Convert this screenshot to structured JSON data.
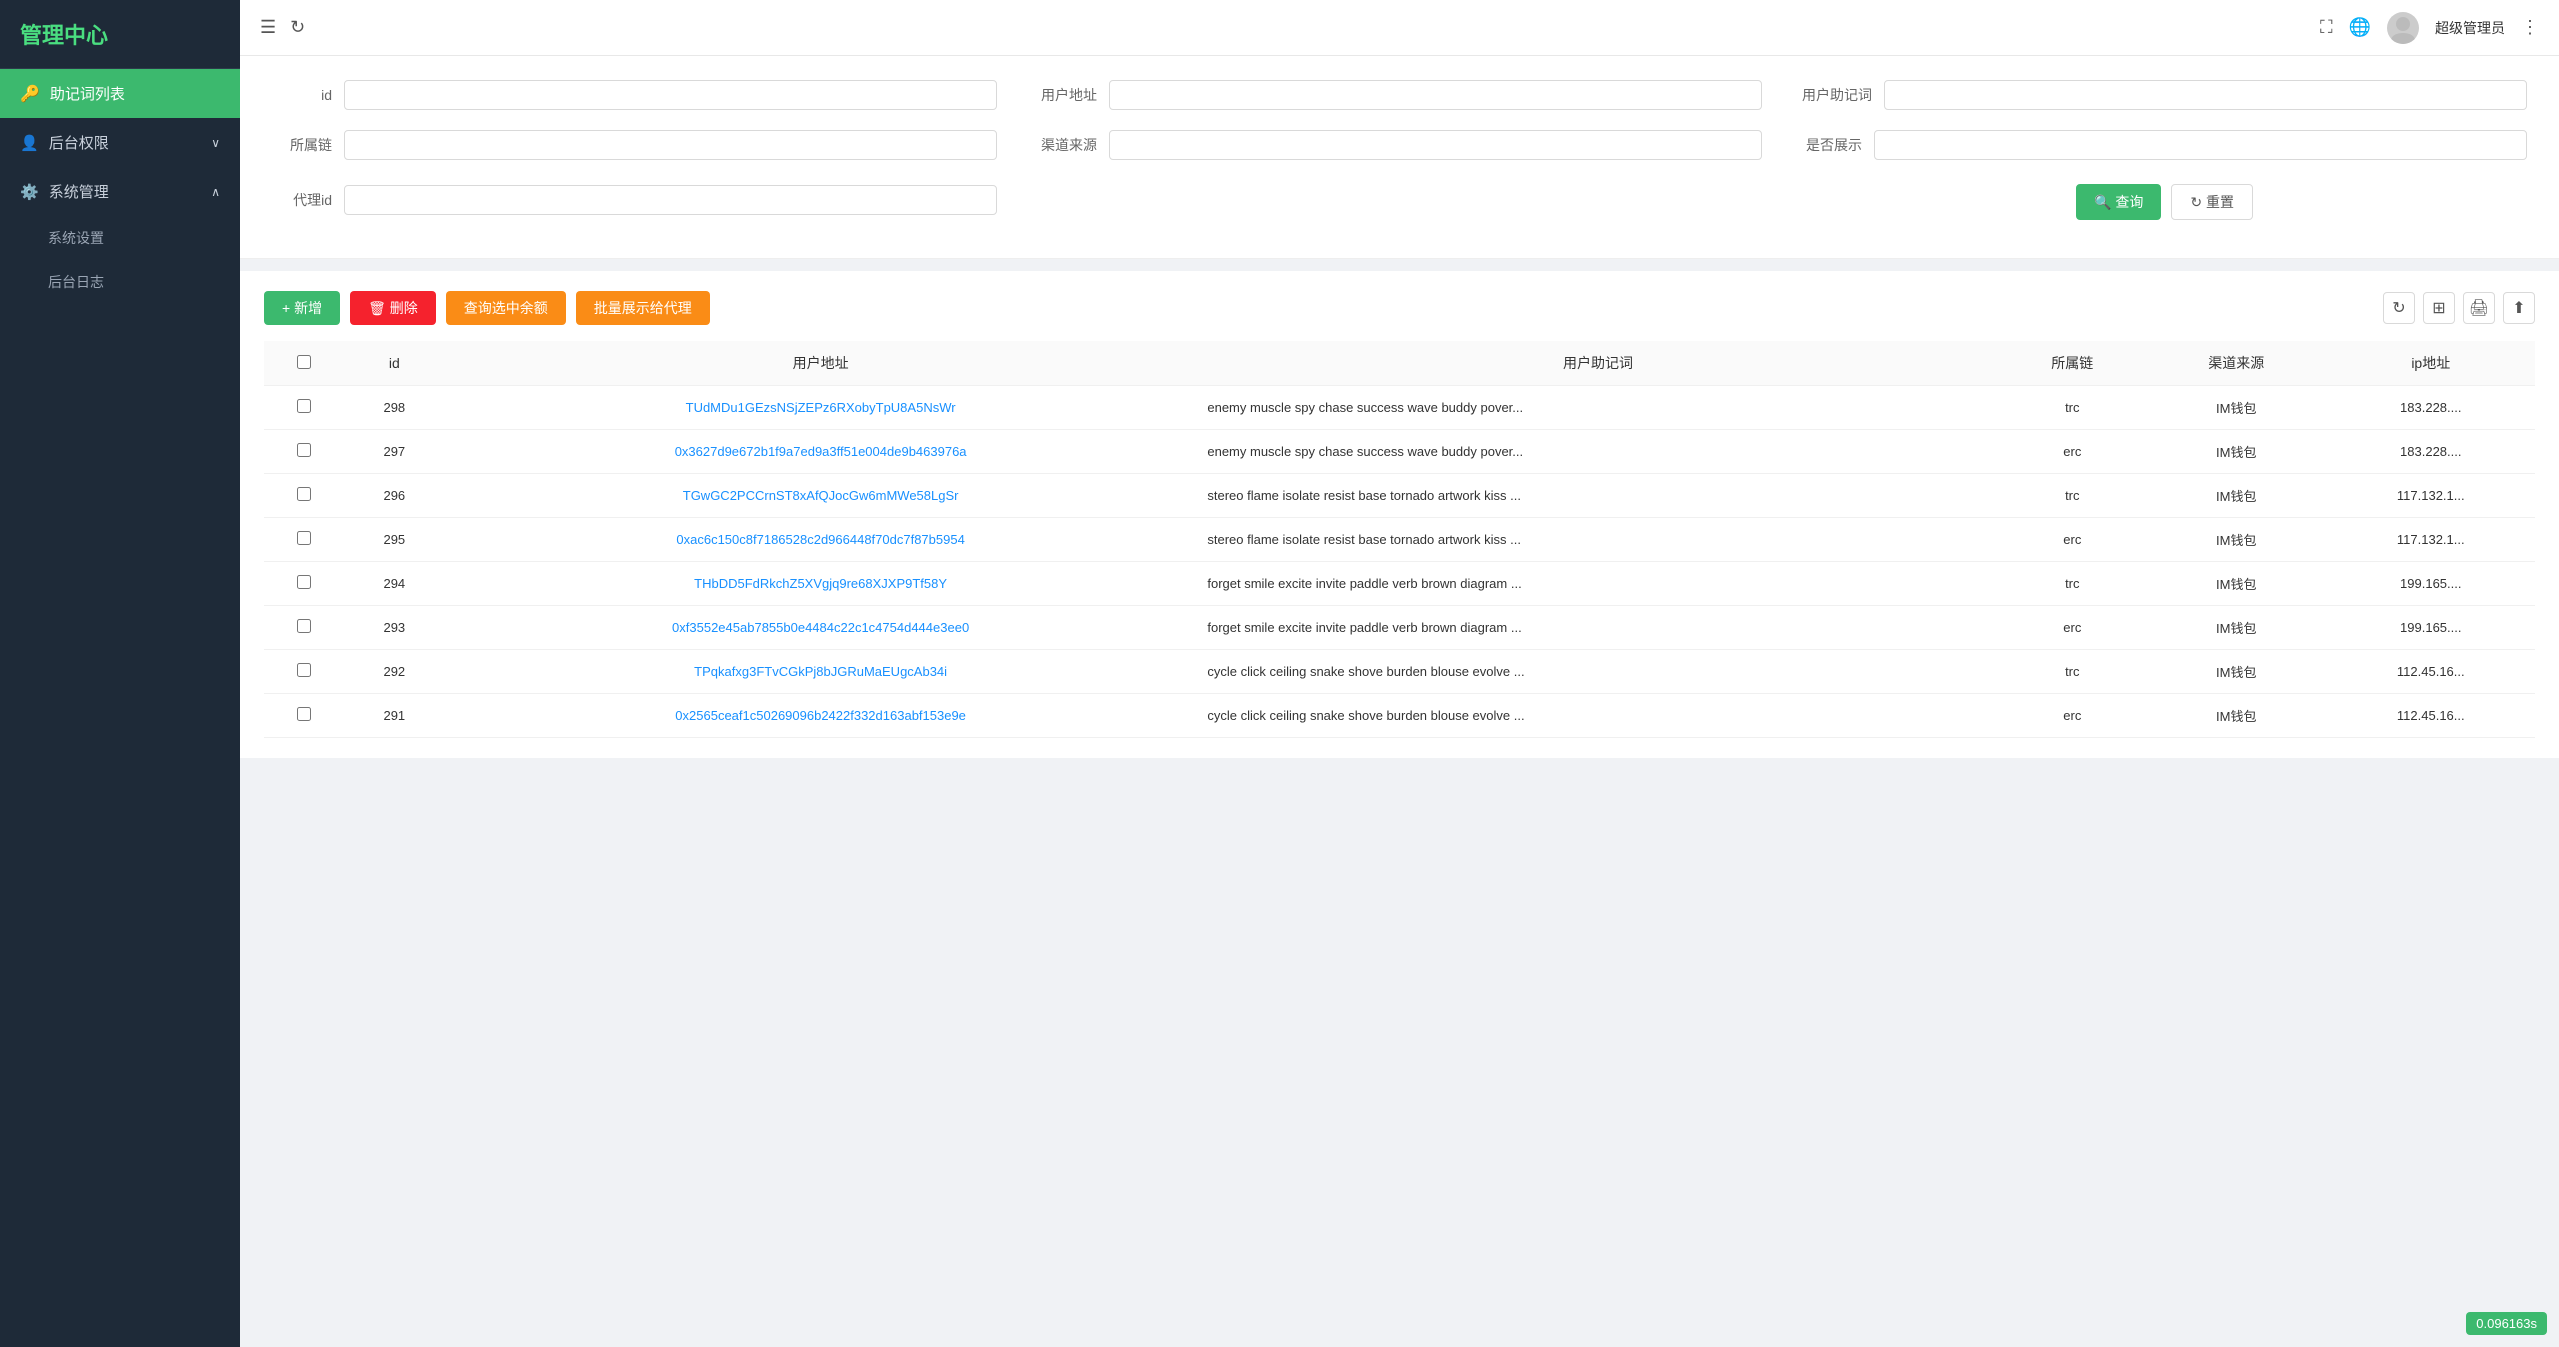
{
  "sidebar": {
    "logo": "管理中心",
    "items": [
      {
        "id": "mnemonic-list",
        "label": "助记词列表",
        "icon": "🔑",
        "active": true
      },
      {
        "id": "backend-permissions",
        "label": "后台权限",
        "icon": "👤",
        "expandable": true,
        "expanded": false
      },
      {
        "id": "system-management",
        "label": "系统管理",
        "icon": "⚙️",
        "expandable": true,
        "expanded": true
      }
    ],
    "sub_items": [
      {
        "id": "system-settings",
        "label": "系统设置"
      },
      {
        "id": "backend-log",
        "label": "后台日志"
      }
    ]
  },
  "topbar": {
    "menu_icon": "☰",
    "refresh_icon": "↻",
    "fullscreen_icon": "⛶",
    "globe_icon": "🌐",
    "username": "超级管理员",
    "more_icon": "⋮"
  },
  "filter": {
    "fields": [
      {
        "id": "id",
        "label": "id",
        "placeholder": ""
      },
      {
        "id": "user-address",
        "label": "用户地址",
        "placeholder": ""
      },
      {
        "id": "user-mnemonic",
        "label": "用户助记词",
        "placeholder": ""
      },
      {
        "id": "chain",
        "label": "所属链",
        "placeholder": ""
      },
      {
        "id": "channel-source",
        "label": "渠道来源",
        "placeholder": ""
      },
      {
        "id": "show-status",
        "label": "是否展示",
        "placeholder": ""
      },
      {
        "id": "agent-id",
        "label": "代理id",
        "placeholder": ""
      }
    ],
    "search_label": "🔍 查询",
    "reset_label": "↻ 重置"
  },
  "toolbar": {
    "add_label": "+ 新增",
    "delete_label": "🗑 删除",
    "query_balance_label": "查询选中余额",
    "batch_show_label": "批量展示给代理"
  },
  "table": {
    "columns": [
      "id",
      "用户地址",
      "用户助记词",
      "所属链",
      "渠道来源",
      "ip地址"
    ],
    "rows": [
      {
        "id": "298",
        "address": "TUdMDu1GEzsNSjZEPz6RXobyTpU8A5NsWr",
        "address_type": "trc",
        "mnemonic": "enemy muscle spy chase success wave buddy pover...",
        "chain": "trc",
        "source": "IM钱包",
        "ip": "183.228...."
      },
      {
        "id": "297",
        "address": "0x3627d9e672b1f9a7ed9a3ff51e004de9b463976a",
        "address_type": "erc",
        "mnemonic": "enemy muscle spy chase success wave buddy pover...",
        "chain": "erc",
        "source": "IM钱包",
        "ip": "183.228...."
      },
      {
        "id": "296",
        "address": "TGwGC2PCCrnST8xAfQJocGw6mMWe58LgSr",
        "address_type": "trc",
        "mnemonic": "stereo flame isolate resist base tornado artwork kiss ...",
        "chain": "trc",
        "source": "IM钱包",
        "ip": "117.132.1..."
      },
      {
        "id": "295",
        "address": "0xac6c150c8f7186528c2d966448f70dc7f87b5954",
        "address_type": "erc",
        "mnemonic": "stereo flame isolate resist base tornado artwork kiss ...",
        "chain": "erc",
        "source": "IM钱包",
        "ip": "117.132.1..."
      },
      {
        "id": "294",
        "address": "THbDD5FdRkchZ5XVgjq9re68XJXP9Tf58Y",
        "address_type": "trc",
        "mnemonic": "forget smile excite invite paddle verb brown diagram ...",
        "chain": "trc",
        "source": "IM钱包",
        "ip": "199.165...."
      },
      {
        "id": "293",
        "address": "0xf3552e45ab7855b0e4484c22c1c4754d444e3ee0",
        "address_type": "erc",
        "mnemonic": "forget smile excite invite paddle verb brown diagram ...",
        "chain": "erc",
        "source": "IM钱包",
        "ip": "199.165...."
      },
      {
        "id": "292",
        "address": "TPqkafxg3FTvCGkPj8bJGRuMaEUgcAb34i",
        "address_type": "trc",
        "mnemonic": "cycle click ceiling snake shove burden blouse evolve ...",
        "chain": "trc",
        "source": "IM钱包",
        "ip": "112.45.16..."
      },
      {
        "id": "291",
        "address": "0x2565ceaf1c50269096b2422f332d163abf153e9e",
        "address_type": "erc",
        "mnemonic": "cycle click ceiling snake shove burden blouse evolve ...",
        "chain": "erc",
        "source": "IM钱包",
        "ip": "112.45.16..."
      }
    ]
  },
  "version": "0.096163s"
}
